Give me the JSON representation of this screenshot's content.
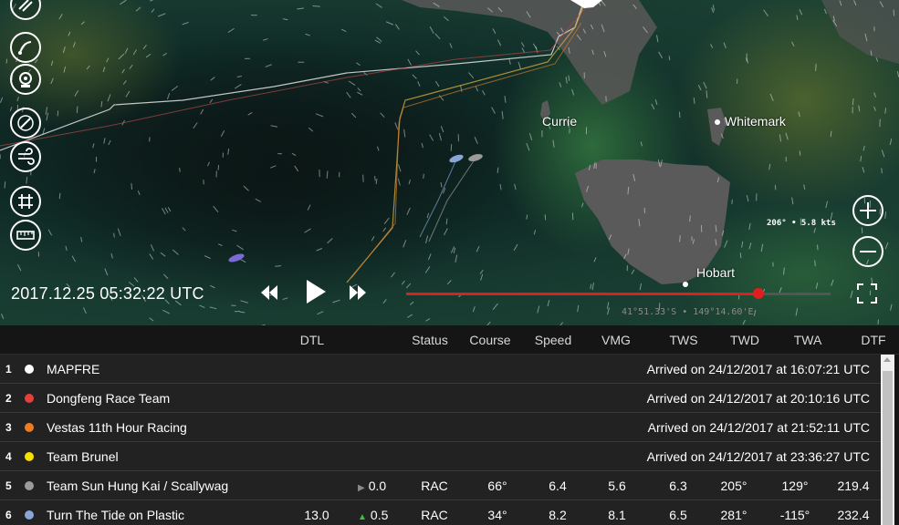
{
  "map": {
    "places": [
      "Currie",
      "Whitemark",
      "Hobart"
    ],
    "wind_readout": "206° • 5.8 kts",
    "coords": "41°51.33'S • 149°14.60'E",
    "timestamp": "2017.12.25 05:32:22 UTC",
    "tools": [
      "layers-icon",
      "route-icon",
      "camera-icon",
      "compass-icon",
      "wind-icon",
      "grid-icon",
      "ruler-icon"
    ],
    "timeline_progress": 0.83
  },
  "table": {
    "headers": [
      "DTL",
      "Status",
      "Course",
      "Speed",
      "VMG",
      "TWS",
      "TWD",
      "TWA",
      "DTF"
    ],
    "rows": [
      {
        "rank": "1",
        "team": "MAPFRE",
        "color": "#ffffff",
        "arrived": "Arrived on 24/12/2017 at 16:07:21 UTC"
      },
      {
        "rank": "2",
        "team": "Dongfeng Race Team",
        "color": "#e5403a",
        "arrived": "Arrived on 24/12/2017 at 20:10:16 UTC"
      },
      {
        "rank": "3",
        "team": "Vestas 11th Hour Racing",
        "color": "#f07c21",
        "arrived": "Arrived on 24/12/2017 at 21:52:11 UTC"
      },
      {
        "rank": "4",
        "team": "Team Brunel",
        "color": "#f5e000",
        "arrived": "Arrived on 24/12/2017 at 23:36:27 UTC"
      },
      {
        "rank": "5",
        "team": "Team Sun Hung Kai / Scallywag",
        "color": "#9b9b9b",
        "dtl": "",
        "delta_arrow": "▶",
        "delta_color": "#888888",
        "delta": "0.0",
        "status": "RAC",
        "course": "66°",
        "speed": "6.4",
        "vmg": "5.6",
        "tws": "6.3",
        "twd": "205°",
        "twa": "129°",
        "dtf": "219.4"
      },
      {
        "rank": "6",
        "team": "Turn The Tide on Plastic",
        "color": "#8aa6d6",
        "dtl": "13.0",
        "delta_arrow": "▲",
        "delta_color": "#3cc13c",
        "delta": "0.5",
        "status": "RAC",
        "course": "34°",
        "speed": "8.2",
        "vmg": "8.1",
        "tws": "6.5",
        "twd": "281°",
        "twa": "-115°",
        "dtf": "232.4"
      }
    ]
  }
}
